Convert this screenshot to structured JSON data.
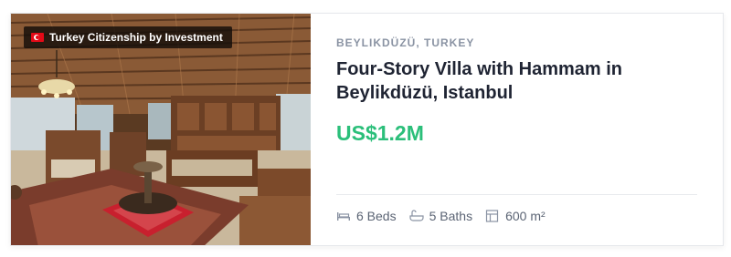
{
  "badge": {
    "label": "Turkey Citizenship by Investment",
    "flag_icon": "turkey-flag-icon"
  },
  "listing": {
    "location": "BEYLIKDÜZÜ, TURKEY",
    "title": "Four-Story Villa with Hammam in Beylikdüzü, Istanbul",
    "price": "US$1.2M",
    "price_color": "#2bbf7a"
  },
  "features": [
    {
      "icon": "bed-icon",
      "label": "6 Beds"
    },
    {
      "icon": "bath-icon",
      "label": "5 Baths"
    },
    {
      "icon": "area-icon",
      "label": "600 m²"
    }
  ]
}
